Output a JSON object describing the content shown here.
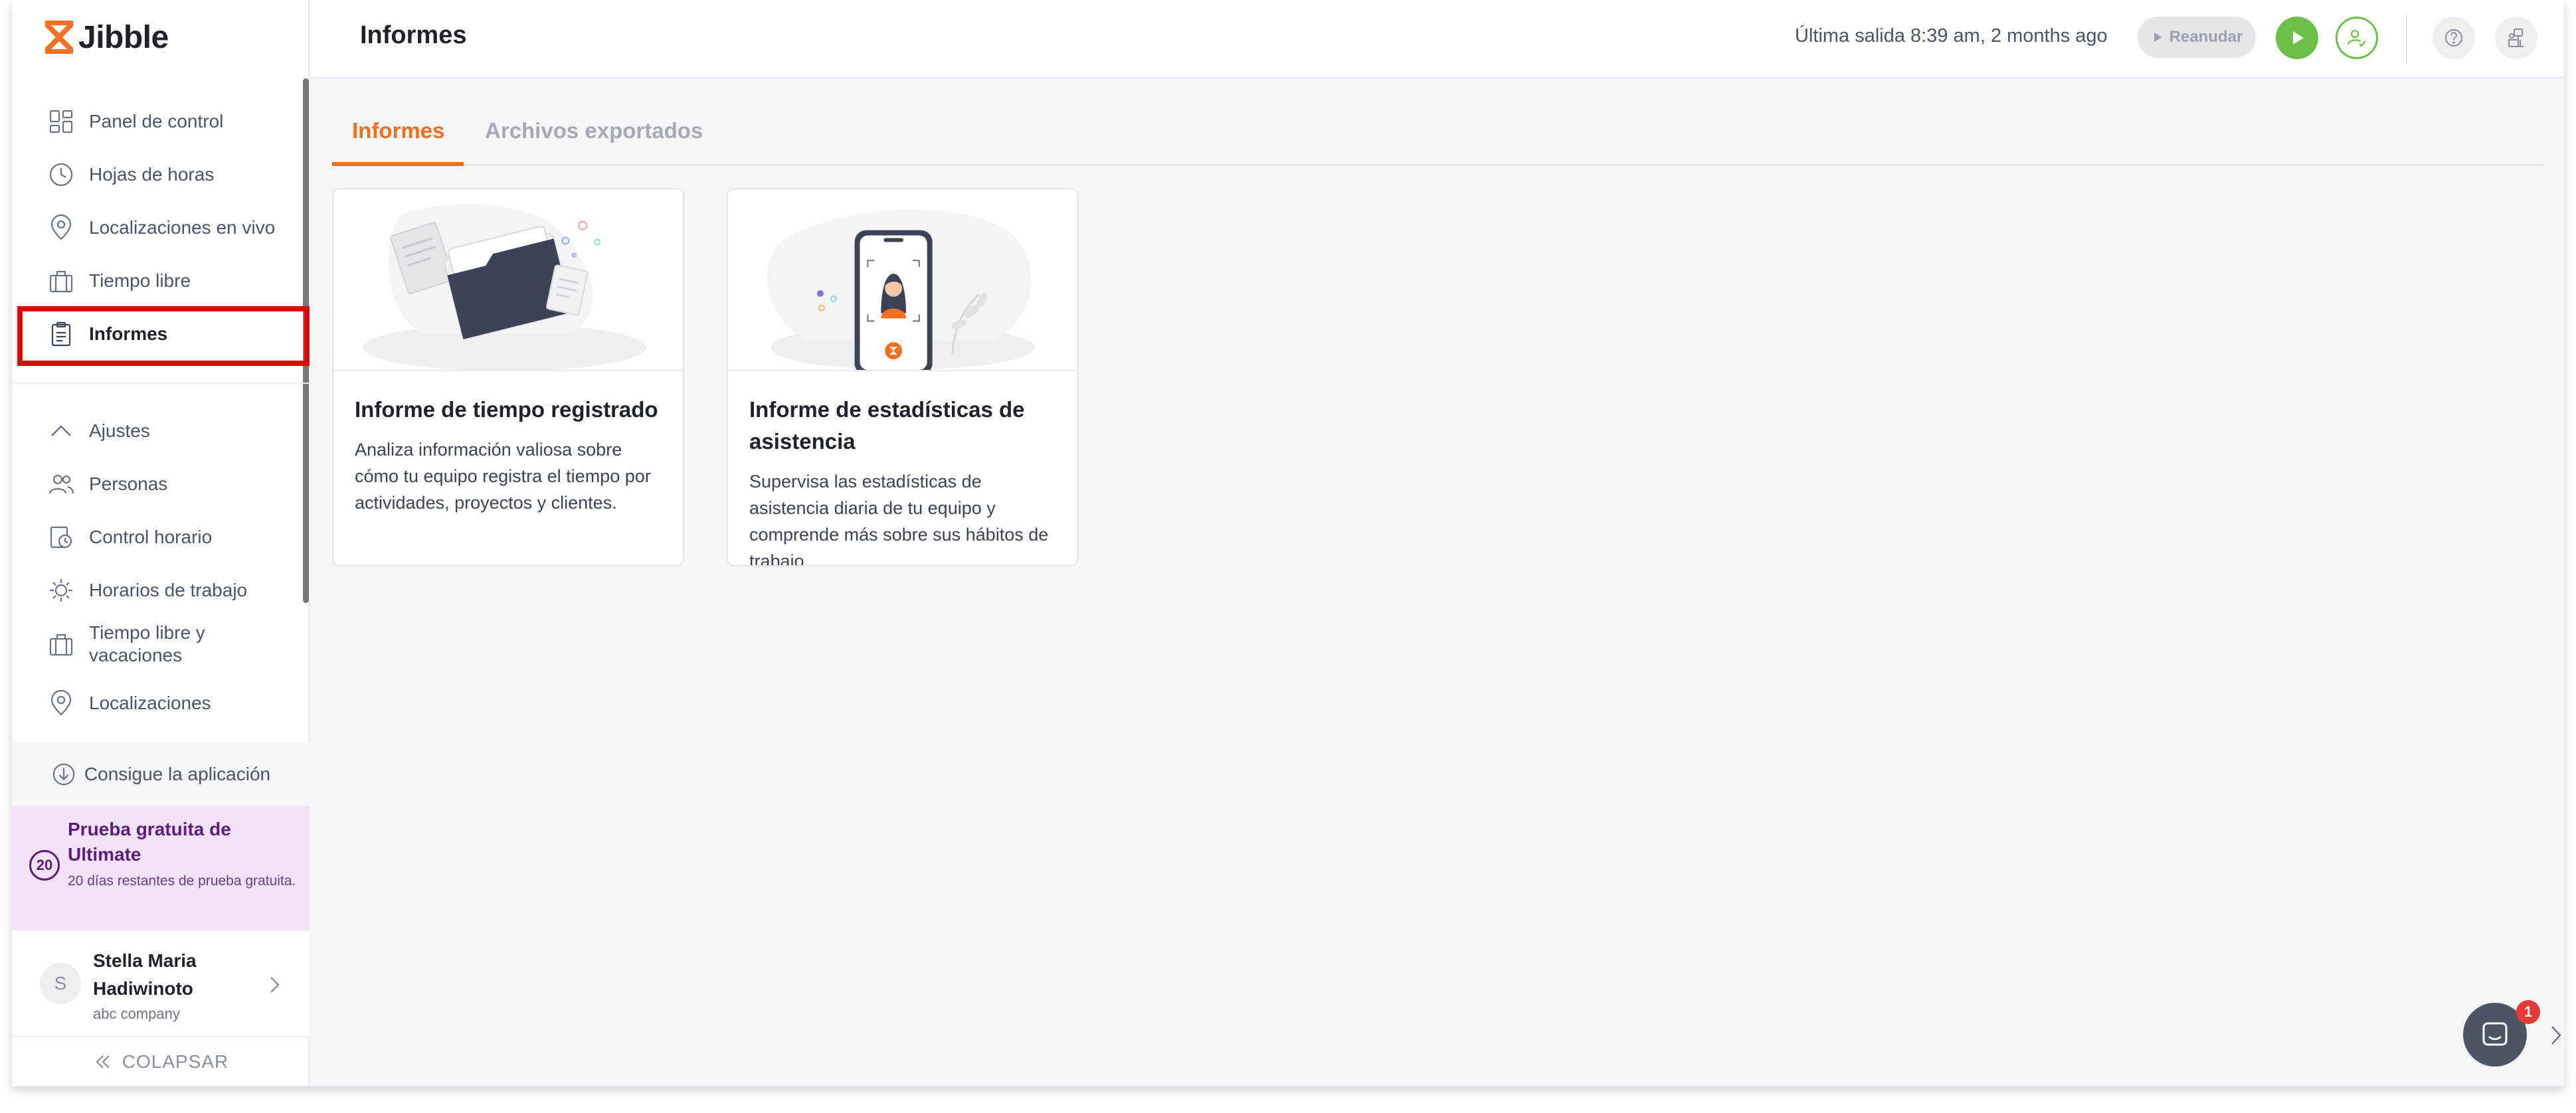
{
  "app": {
    "logo_text": "Jibble",
    "brand_color": "#f37021"
  },
  "sidebar": {
    "items": [
      {
        "label": "Panel de control",
        "icon": "dashboard-icon"
      },
      {
        "label": "Hojas de horas",
        "icon": "clock-icon"
      },
      {
        "label": "Localizaciones en vivo",
        "icon": "location-pin-icon"
      },
      {
        "label": "Tiempo libre",
        "icon": "briefcase-icon"
      },
      {
        "label": "Informes",
        "icon": "clipboard-icon",
        "active": true
      }
    ],
    "settings_label": "Ajustes",
    "settings_items": [
      {
        "label": "Personas",
        "icon": "people-icon"
      },
      {
        "label": "Control horario",
        "icon": "time-tracking-icon"
      },
      {
        "label": "Horarios de trabajo",
        "icon": "work-schedule-icon"
      },
      {
        "label": "Tiempo libre y vacaciones",
        "icon": "briefcase-icon"
      },
      {
        "label": "Localizaciones",
        "icon": "location-pin-icon"
      }
    ],
    "get_app": "Consigue la aplicación",
    "trial": {
      "days": "20",
      "title": "Prueba gratuita de Ultimate",
      "subtitle": "20 días restantes de prueba gratuita."
    },
    "user": {
      "initial": "S",
      "name": "Stella Maria Hadiwinoto",
      "company": "abc company"
    },
    "collapse": "COLAPSAR"
  },
  "header": {
    "title": "Informes",
    "last_out": "Última salida 8:39 am, 2 months ago",
    "resume_label": "Reanudar"
  },
  "tabs": [
    {
      "label": "Informes",
      "active": true
    },
    {
      "label": "Archivos exportados",
      "active": false
    }
  ],
  "cards": [
    {
      "title": "Informe de tiempo registrado",
      "description": "Analiza información valiosa sobre cómo tu equipo registra el tiempo por actividades, proyectos y clientes."
    },
    {
      "title": "Informe de estadísticas de asistencia",
      "description": "Supervisa las estadísticas de asistencia diaria de tu equipo y comprende más sobre sus hábitos de trabajo."
    }
  ],
  "chat": {
    "badge": "1"
  }
}
